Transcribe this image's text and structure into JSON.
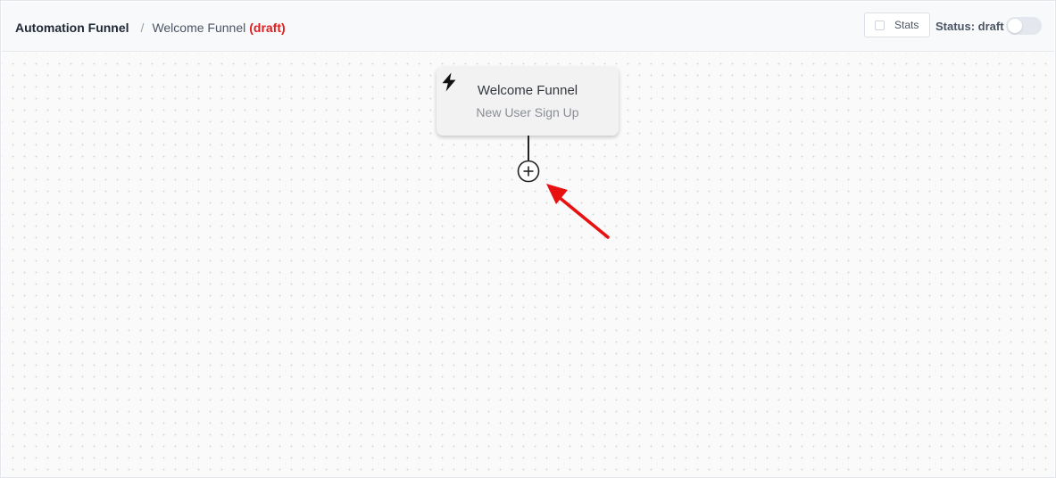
{
  "header": {
    "breadcrumb_root": "Automation Funnel",
    "breadcrumb_separator": "/",
    "breadcrumb_current": "Welcome Funnel",
    "breadcrumb_status": "(draft)",
    "stats_label": "Stats",
    "status_label": "Status: draft",
    "status_toggle_on": false
  },
  "funnel": {
    "trigger": {
      "icon": "lightning-bolt-icon",
      "title": "Welcome Funnel",
      "subtitle": "New User Sign Up"
    },
    "add_step_icon": "plus-circle-icon"
  },
  "annotation": {
    "arrow_color": "#e81010"
  },
  "colors": {
    "draft_status": "#e11d1d",
    "header_bg": "#f7f9fb",
    "canvas_bg": "#fafafa",
    "card_bg": "#f2f2f2"
  }
}
